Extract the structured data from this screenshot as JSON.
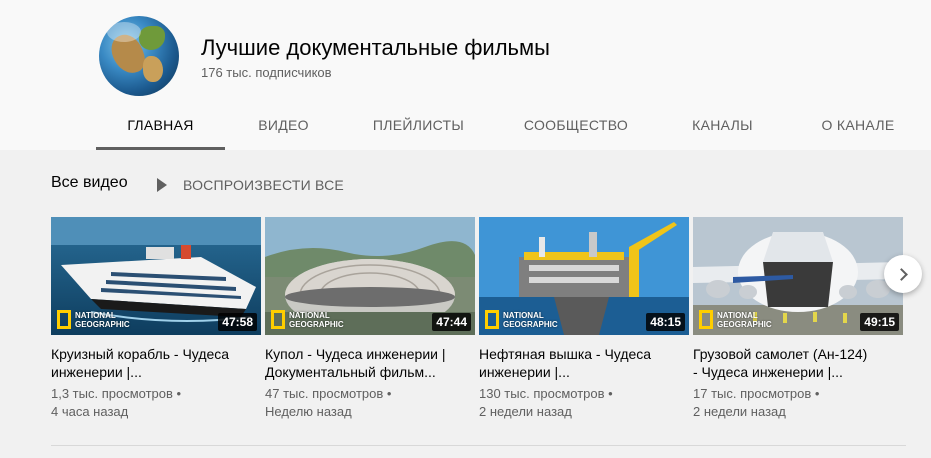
{
  "channel": {
    "title": "Лучшие документальные фильмы",
    "subscribers": "176 тыс. подписчиков"
  },
  "tabs": [
    {
      "label": "ГЛАВНАЯ",
      "active": true
    },
    {
      "label": "ВИДЕО",
      "active": false
    },
    {
      "label": "ПЛЕЙЛИСТЫ",
      "active": false
    },
    {
      "label": "СООБЩЕСТВО",
      "active": false
    },
    {
      "label": "КАНАЛЫ",
      "active": false
    },
    {
      "label": "О КАНАЛЕ",
      "active": false
    }
  ],
  "section": {
    "title": "Все видео",
    "play_all": "ВОСПРОИЗВЕСТИ ВСЕ",
    "play_icon": "play-icon"
  },
  "videos": [
    {
      "title_line1": "Круизный корабль - Чудеса",
      "title_line2": "инженерии |...",
      "duration": "47:58",
      "views": "1,3 тыс. просмотров",
      "age": "4 часа назад",
      "logo_line1": "NATIONAL",
      "logo_line2": "GEOGRAPHIC"
    },
    {
      "title_line1": "Купол - Чудеса инженерии |",
      "title_line2": "Документальный фильм...",
      "duration": "47:44",
      "views": "47 тыс. просмотров",
      "age": "Неделю назад",
      "logo_line1": "NATIONAL",
      "logo_line2": "GEOGRAPHIC"
    },
    {
      "title_line1": "Нефтяная вышка - Чудеса",
      "title_line2": "инженерии |...",
      "duration": "48:15",
      "views": "130 тыс. просмотров",
      "age": "2 недели назад",
      "logo_line1": "NATIONAL",
      "logo_line2": "GEOGRAPHIC"
    },
    {
      "title_line1": "Грузовой самолет (Ан-124)",
      "title_line2": "- Чудеса инженерии |...",
      "duration": "49:15",
      "views": "17 тыс. просмотров",
      "age": "2 недели назад",
      "logo_line1": "NATIONAL",
      "logo_line2": "GEOGRAPHIC"
    }
  ],
  "meta_separator": "•",
  "next_icon": "chevron-right-icon",
  "colors": {
    "background_header": "#f9f9f9",
    "background_content": "#f1f1f1",
    "text_primary": "#030303",
    "text_secondary": "#606060",
    "ng_yellow": "#ffce00"
  }
}
